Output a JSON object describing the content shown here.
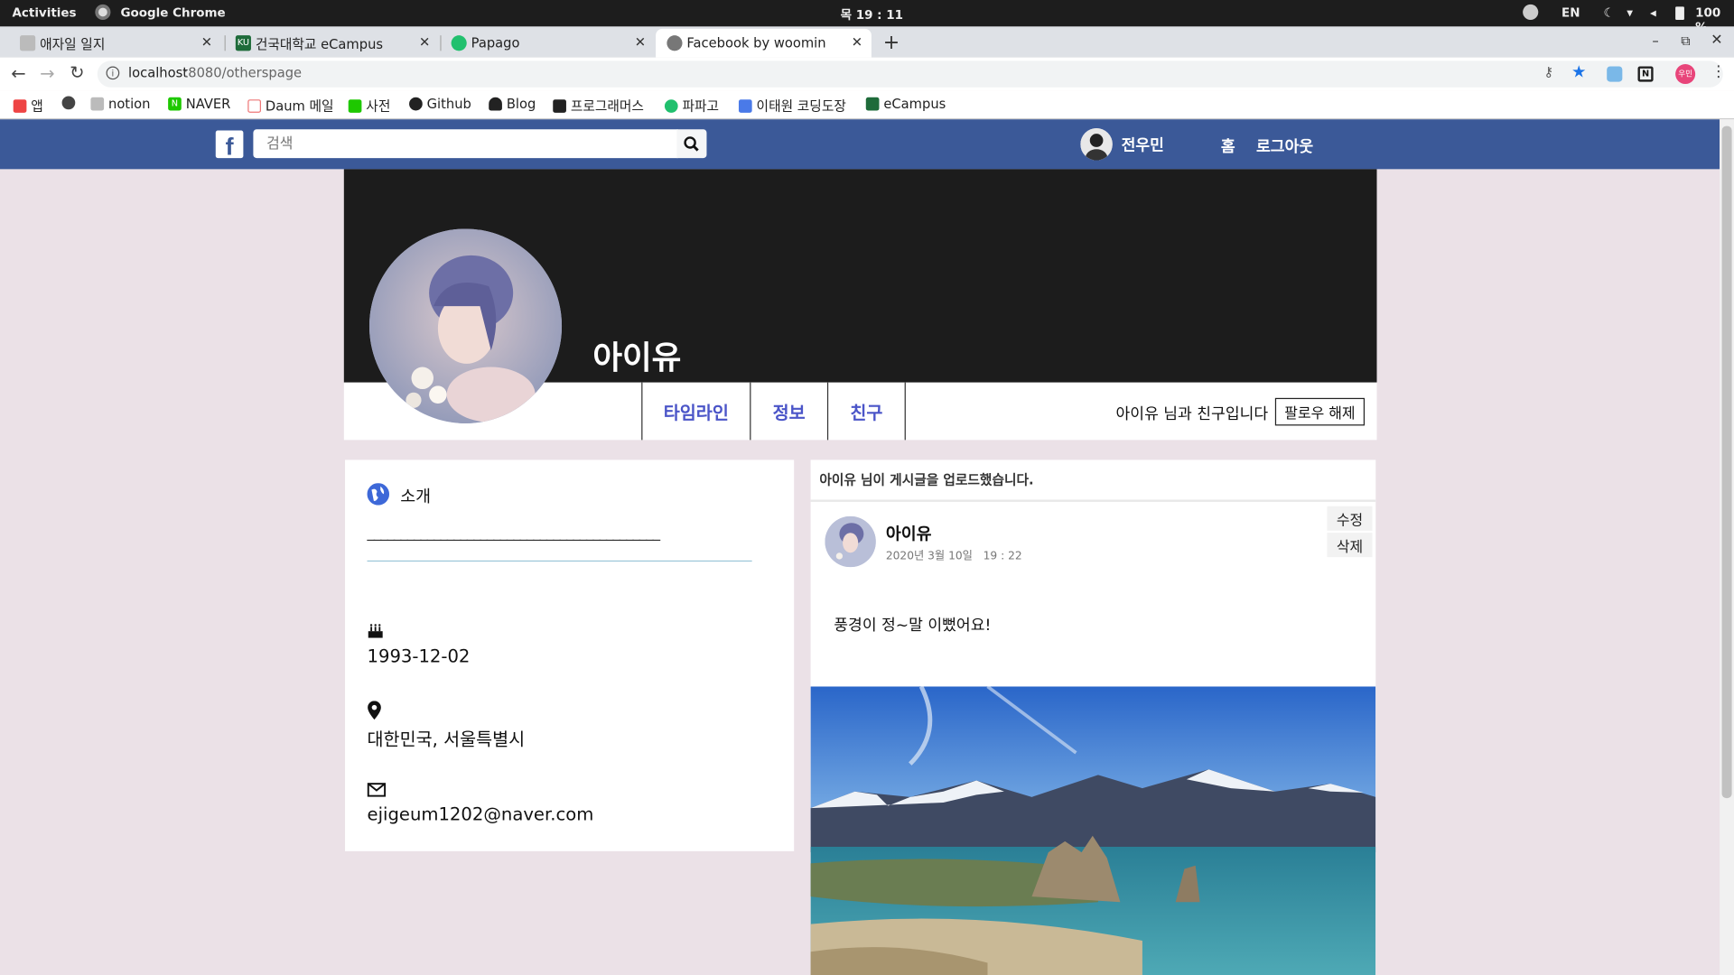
{
  "system": {
    "activities": "Activities",
    "app": "Google Chrome",
    "clock": "목 19 : 11",
    "lang": "EN",
    "battery": "100 %"
  },
  "browser": {
    "tabs": [
      {
        "title": "애자일 일지",
        "fav": ""
      },
      {
        "title": "건국대학교 eCampus",
        "fav": "KU"
      },
      {
        "title": "Papago",
        "fav": ""
      },
      {
        "title": "Facebook by woomin",
        "fav": ""
      }
    ],
    "url_host": "localhost",
    "url_rest": ":8080/otherspage",
    "profile_badge": "우민"
  },
  "bookmarks": [
    "앱",
    "notion",
    "NAVER",
    "Daum 메일",
    "사전",
    "Github",
    "Blog",
    "프로그래머스",
    "파파고",
    "이태원 코딩도장",
    "eCampus"
  ],
  "fbheader": {
    "logo": "f",
    "search_placeholder": "검색",
    "user": "전우민",
    "home": "홈",
    "logout": "로그아웃"
  },
  "profile": {
    "name": "아이유",
    "tabs": [
      "타임라인",
      "정보",
      "친구"
    ],
    "friend_text": "아이유 님과 친구입니다",
    "unfollow": "팔로우 해제"
  },
  "intro": {
    "title": "소개",
    "underline": "____________________________________________",
    "birthday": "1993-12-02",
    "location": "대한민국, 서울특별시",
    "email": "ejigeum1202@naver.com"
  },
  "post": {
    "header": "아이유 님이 게시글을 업로드했습니다.",
    "author": "아이유",
    "date": "2020년 3월 10일   19 : 22",
    "edit": "수정",
    "delete": "삭제",
    "body": "풍경이 정~말 이뻤어요!"
  },
  "colors": {
    "fb_blue": "#3b5998",
    "page_bg": "#ebe1e7",
    "tab_text": "#4b55c8"
  }
}
